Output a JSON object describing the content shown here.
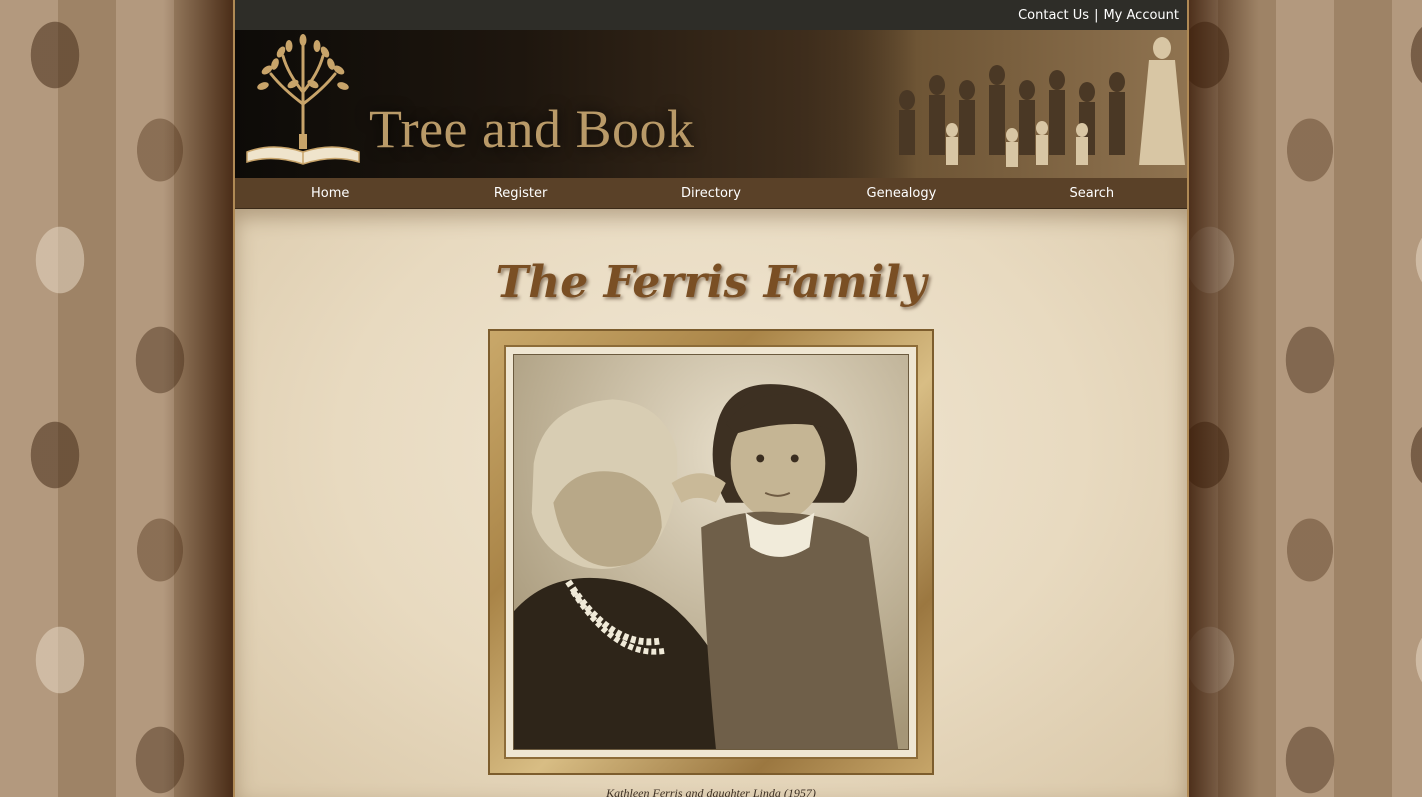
{
  "topbar": {
    "contact_label": "Contact Us",
    "separator": "|",
    "account_label": "My Account"
  },
  "banner": {
    "site_title": "Tree and Book",
    "logo_icon": "tree-and-open-book-icon"
  },
  "nav": {
    "items": [
      {
        "label": "Home"
      },
      {
        "label": "Register"
      },
      {
        "label": "Directory"
      },
      {
        "label": "Genealogy"
      },
      {
        "label": "Search"
      }
    ]
  },
  "main": {
    "title": "The Ferris Family",
    "photo_caption": "Kathleen Ferris and daughter Linda (1957)"
  },
  "colors": {
    "topbar_bg": "#2e2d28",
    "nav_bg": "#5a4128",
    "title_brown": "#7a4f24",
    "frame_gold": "#c9a86a"
  }
}
